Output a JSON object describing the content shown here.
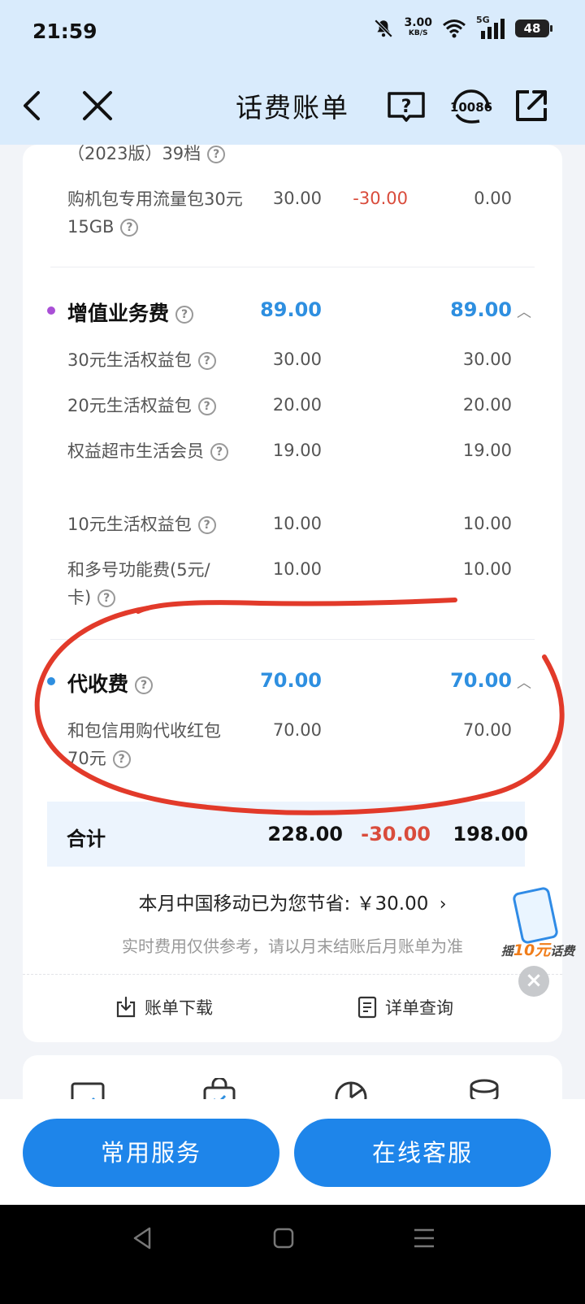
{
  "status_bar": {
    "time": "21:59",
    "speed": "3.00",
    "speed_unit": "KB/S",
    "network": "5G",
    "battery": "48"
  },
  "header": {
    "title": "话费账单",
    "service_number": "10086"
  },
  "bill": {
    "rows_top": [
      {
        "name": "（2023版）39档",
        "v1": "",
        "v2": "",
        "v3": ""
      },
      {
        "name": "购机包专用流量包30元15GB",
        "v1": "30.00",
        "v2": "-30.00",
        "v3": "0.00"
      }
    ],
    "sections": [
      {
        "title": "增值业务费",
        "total": "89.00",
        "total_after": "89.00",
        "items": [
          {
            "name": "30元生活权益包",
            "v1": "30.00",
            "v3": "30.00"
          },
          {
            "name": "20元生活权益包",
            "v1": "20.00",
            "v3": "20.00"
          },
          {
            "name": "权益超市生活会员",
            "v1": "19.00",
            "v3": "19.00"
          },
          {
            "name": "10元生活权益包",
            "v1": "10.00",
            "v3": "10.00"
          },
          {
            "name": "和多号功能费(5元/卡)",
            "v1": "10.00",
            "v3": "10.00"
          }
        ],
        "dot_color": "#a94fd6"
      },
      {
        "title": "代收费",
        "total": "70.00",
        "total_after": "70.00",
        "items": [
          {
            "name": "和包信用购代收红包70元",
            "v1": "70.00",
            "v3": "70.00"
          }
        ],
        "dot_color": "#2e8fe0"
      }
    ],
    "summary": {
      "label": "合计",
      "total": "228.00",
      "discount": "-30.00",
      "final": "198.00"
    },
    "saving_text": "本月中国移动已为您节省: ￥30.00",
    "note": "实时费用仅供参考，请以月末结账后月账单为准",
    "actions": {
      "download": "账单下载",
      "detail": "详单查询"
    }
  },
  "promo": {
    "text_pre": "摇",
    "text_num": "10元",
    "text_post": "话费"
  },
  "bottom": {
    "common_services": "常用服务",
    "online_service": "在线客服"
  },
  "colors": {
    "accent": "#1e85ea",
    "negative": "#d94c3c",
    "header_bg": "#d9ebfc"
  }
}
